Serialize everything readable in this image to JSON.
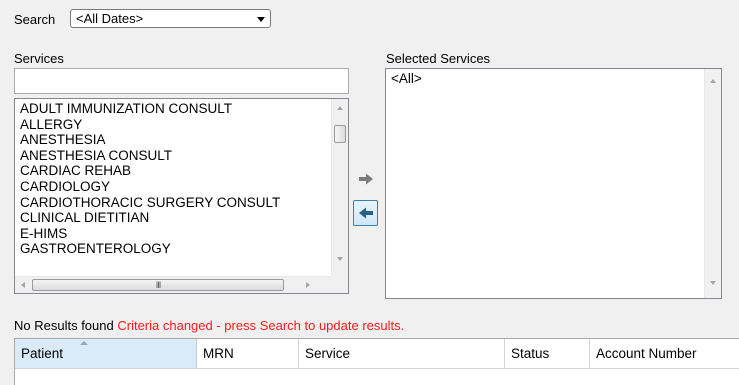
{
  "search": {
    "label": "Search",
    "selected": "<All Dates>"
  },
  "services": {
    "label": "Services",
    "filter_value": "",
    "items": [
      "ADULT IMMUNIZATION CONSULT",
      "ALLERGY",
      "ANESTHESIA",
      "ANESTHESIA CONSULT",
      "CARDIAC REHAB",
      "CARDIOLOGY",
      "CARDIOTHORACIC SURGERY CONSULT",
      "CLINICAL DIETITIAN",
      "E-HIMS",
      "GASTROENTEROLOGY"
    ],
    "hscroll_grip": "III"
  },
  "move_buttons": {
    "add_icon": "arrow-right-icon",
    "remove_icon": "arrow-left-icon"
  },
  "selected_services": {
    "label": "Selected Services",
    "items": [
      "<All>"
    ]
  },
  "status": {
    "results": "No Results found",
    "message": "Criteria changed - press Search to update results.",
    "message_color": "#ff1a1a"
  },
  "grid": {
    "columns": [
      "Patient",
      "MRN",
      "Service",
      "Status",
      "Account Number"
    ]
  },
  "colors": {
    "background": "#f0f0f0",
    "selected_header": "#d9ebf9",
    "button_border": "#3c7fb1"
  }
}
